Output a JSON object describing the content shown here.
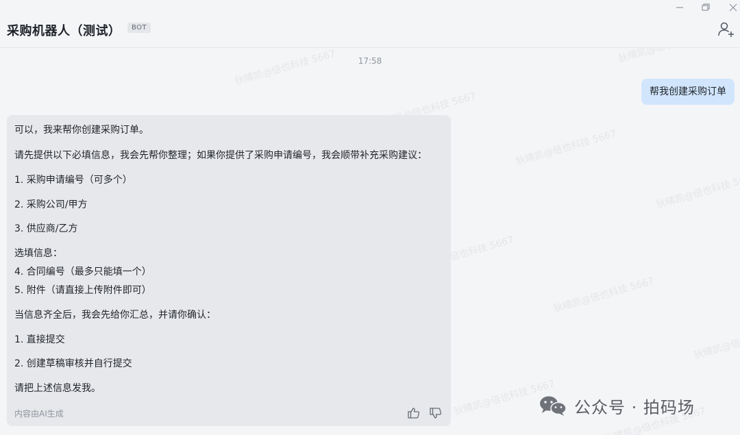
{
  "window": {
    "title": "采购机器人（测试）",
    "badge": "BOT"
  },
  "chat": {
    "timestamp": "17:58",
    "user_message": "帮我创建采购订单",
    "bot_message": {
      "lines": [
        "可以，我来帮你创建采购订单。",
        "请先提供以下必填信息，我会先帮你整理；如果你提供了采购申请编号，我会顺带补充采购建议：",
        "1. 采购申请编号（可多个）",
        "2. 采购公司/甲方",
        "3. 供应商/乙方",
        "选填信息：",
        "4. 合同编号（最多只能填一个）",
        "5. 附件（请直接上传附件即可）",
        "当信息齐全后，我会先给你汇总，并请你确认：",
        "1. 直接提交",
        "2. 创建草稿审核并自行提交",
        "请把上述信息发我。"
      ],
      "ai_note": "内容由AI生成"
    }
  },
  "watermark_text": "狄晴凯@倍也科技 5667",
  "overlay": {
    "brand": "公众号 · 拍码场"
  },
  "icons": {
    "minimize": "minimize-icon",
    "maximize": "restore-icon",
    "close": "close-icon",
    "add_member": "add-member-icon",
    "like": "thumbs-up-icon",
    "dislike": "thumbs-down-icon",
    "wechat": "wechat-icon"
  },
  "colors": {
    "background": "#f4f5f7",
    "user_bubble": "#d1e6fd",
    "bot_bubble": "#e7e8eb",
    "text": "#1f2329",
    "muted": "#8f959e"
  }
}
